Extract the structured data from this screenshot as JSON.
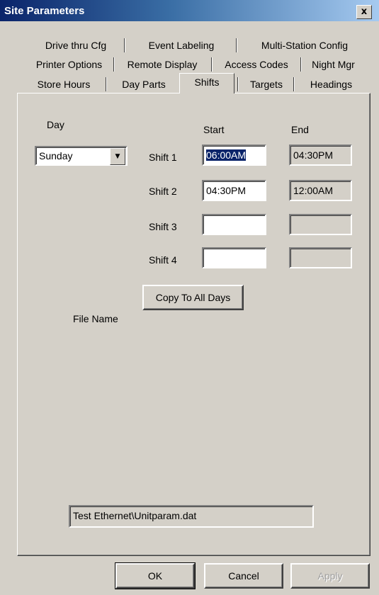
{
  "window": {
    "title": "Site Parameters",
    "close_label": "x"
  },
  "tabs": {
    "row1": [
      "Drive thru Cfg",
      "Event Labeling",
      "Multi-Station Config"
    ],
    "row2": [
      "Printer Options",
      "Remote Display",
      "Access Codes",
      "Night Mgr"
    ],
    "row3": [
      "Store Hours",
      "Day Parts",
      "Shifts",
      "Targets",
      "Headings"
    ],
    "active": "Shifts"
  },
  "form": {
    "day_label": "Day",
    "day_value": "Sunday",
    "start_header": "Start",
    "end_header": "End",
    "shifts": [
      {
        "label": "Shift 1",
        "start": "06:00AM",
        "end": "04:30PM"
      },
      {
        "label": "Shift 2",
        "start": "04:30PM",
        "end": "12:00AM"
      },
      {
        "label": "Shift 3",
        "start": "",
        "end": ""
      },
      {
        "label": "Shift 4",
        "start": "",
        "end": ""
      }
    ],
    "copy_button": "Copy To All Days",
    "file_name_label": "File Name",
    "file_name_value": "Test Ethernet\\Unitparam.dat"
  },
  "buttons": {
    "ok": "OK",
    "cancel": "Cancel",
    "apply": "Apply"
  },
  "icons": {
    "dropdown": "chevron-down-icon",
    "close": "close-icon"
  },
  "colors": {
    "title_start": "#0a246a",
    "title_end": "#a6caf0",
    "face": "#d4d0c8",
    "selection": "#0a246a"
  }
}
